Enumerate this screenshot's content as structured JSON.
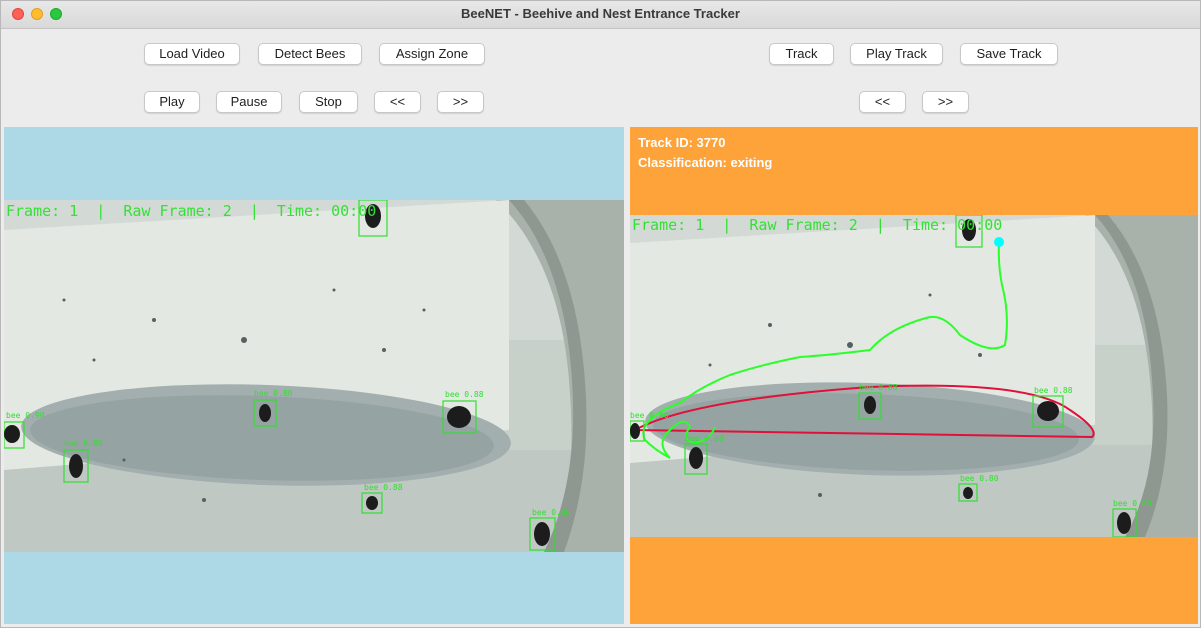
{
  "window": {
    "title": "BeeNET - Beehive and Nest Entrance Tracker"
  },
  "left_toolbar": {
    "row1": {
      "load_video": "Load Video",
      "detect_bees": "Detect Bees",
      "assign_zone": "Assign Zone"
    },
    "row2": {
      "play": "Play",
      "pause": "Pause",
      "stop": "Stop",
      "prev": "<<",
      "next": ">>"
    }
  },
  "right_toolbar": {
    "row1": {
      "track": "Track",
      "play_track": "Play Track",
      "save_track": "Save Track"
    },
    "row2": {
      "prev": "<<",
      "next": ">>"
    }
  },
  "left_pane": {
    "background_color": "#add8e6",
    "overlay_text": "Frame: 1  |  Raw Frame: 2  |  Time: 00:00",
    "detections": [
      {
        "label": "bee 0.90"
      },
      {
        "label": "bee 0.80"
      },
      {
        "label": "bee 0.88"
      },
      {
        "label": "bee 0.88"
      },
      {
        "label": "bee 0.88"
      },
      {
        "label": "bee 0.80"
      }
    ]
  },
  "right_pane": {
    "background_color": "#fea23a",
    "track_id": "Track ID: 3770",
    "classification": "Classification: exiting",
    "overlay_text": "Frame: 1  |  Raw Frame: 2  |  Time: 00:00",
    "detections": [
      {
        "label": "bee 0.88"
      },
      {
        "label": "bee 0.88"
      },
      {
        "label": "bee 0.80"
      },
      {
        "label": "bee 0.80"
      },
      {
        "label": "bee 0.80"
      },
      {
        "label": "bee 0.80"
      }
    ],
    "track_color": "#2aff2a",
    "zone_color": "#e0103a"
  },
  "colors": {
    "detection_box": "#30e030",
    "track_endpoint": "#00ffff"
  }
}
